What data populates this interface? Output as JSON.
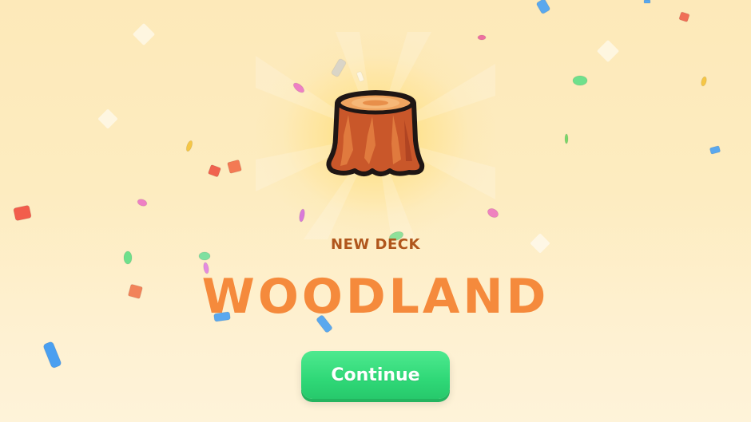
{
  "unlock": {
    "subtitle": "NEW DECK",
    "deck_name": "WOODLAND",
    "continue_label": "Continue",
    "deck_icon": "tree-stump-icon"
  },
  "colors": {
    "background": "#fdebbd",
    "glow": "#ffd65a",
    "subtitle": "#b0561c",
    "title": "#f58a3c",
    "button": "#2fd877",
    "stump_bark": "#c9572a",
    "stump_top": "#f0a560"
  }
}
